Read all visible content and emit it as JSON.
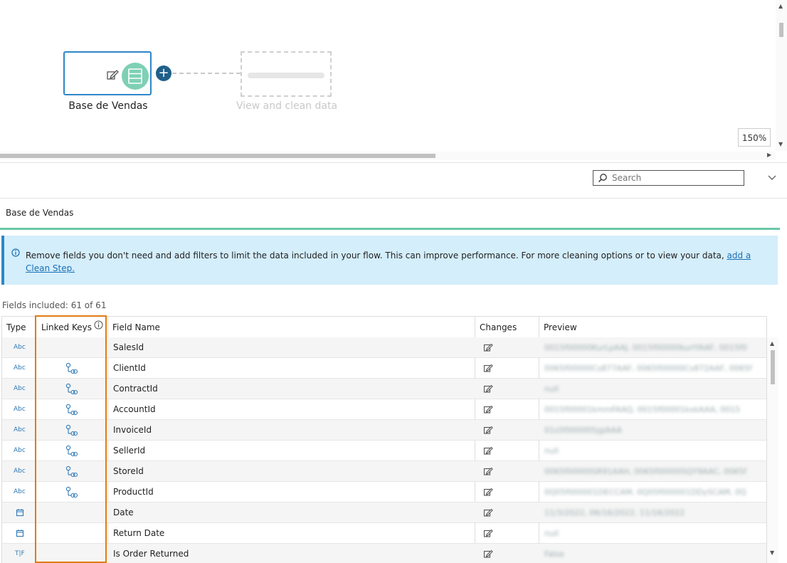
{
  "canvas": {
    "node_label": "Base de Vendas",
    "ghost_label": "View and clean data",
    "zoom": "150%"
  },
  "search": {
    "placeholder": "Search"
  },
  "step_title": "Base de Vendas",
  "banner": {
    "text": "Remove fields you don't need and add filters to limit the data included in your flow. This can improve performance. For more cleaning options or to view your data, ",
    "link": "add a Clean Step."
  },
  "fields_included": "Fields included: 61 of 61",
  "table": {
    "headers": {
      "type": "Type",
      "linked_keys": "Linked Keys",
      "field_name": "Field Name",
      "changes": "Changes",
      "preview": "Preview"
    },
    "rows": [
      {
        "type": "Abc",
        "type_kind": "string",
        "linked": false,
        "name": "SalesId",
        "preview": "0015f00000KurLpAAJ, 0015f00000kurlYAAF, 0015f0"
      },
      {
        "type": "Abc",
        "type_kind": "string",
        "linked": true,
        "name": "ClientId",
        "preview": "0065f00000Cs877AAF, 0065f00000Cs872AAF, 0065f"
      },
      {
        "type": "Abc",
        "type_kind": "string",
        "linked": true,
        "name": "ContractId",
        "preview": "null"
      },
      {
        "type": "Abc",
        "type_kind": "string",
        "linked": true,
        "name": "AccountId",
        "preview": "0015f00001kmmFAAQ, 0015f00001kxkAAA, 0015"
      },
      {
        "type": "Abc",
        "type_kind": "string",
        "linked": true,
        "name": "InvoiceId",
        "preview": "01s5f000005jgiAAA"
      },
      {
        "type": "Abc",
        "type_kind": "string",
        "linked": true,
        "name": "SellerId",
        "preview": "null"
      },
      {
        "type": "Abc",
        "type_kind": "string",
        "linked": true,
        "name": "StoreId",
        "preview": "0065f00000SR91AAH, 0065f00000SQY9AAC, 0065f"
      },
      {
        "type": "Abc",
        "type_kind": "string",
        "linked": true,
        "name": "ProductId",
        "preview": "0Q05f000001DECCAM, 0Q05f000001DDySCAM, 0Q"
      },
      {
        "type": "",
        "type_kind": "date",
        "linked": false,
        "name": "Date",
        "preview": "11/3/2022, 06/16/2022, 11/16/2022"
      },
      {
        "type": "",
        "type_kind": "date",
        "linked": false,
        "name": "Return Date",
        "preview": "null"
      },
      {
        "type": "T|F",
        "type_kind": "bool",
        "linked": false,
        "name": "Is Order Returned",
        "preview": "False"
      }
    ]
  }
}
